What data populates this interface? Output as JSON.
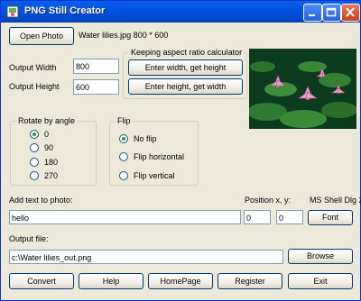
{
  "window": {
    "title": "PNG Still Creator"
  },
  "top": {
    "open_photo": "Open Photo",
    "file_info": "Water lilies.jpg 800 * 600"
  },
  "size": {
    "output_width_label": "Output Width",
    "output_width": "800",
    "output_height_label": "Output Height",
    "output_height": "600"
  },
  "aspect": {
    "title": "Keeping aspect ratio calculator",
    "width_btn": "Enter width, get height",
    "height_btn": "Enter height, get width"
  },
  "rotate": {
    "title": "Rotate by angle",
    "options": [
      "0",
      "90",
      "180",
      "270"
    ],
    "selected": "0"
  },
  "flip": {
    "title": "Flip",
    "options": [
      "No flip",
      "Flip horizontal",
      "Flip vertical"
    ],
    "selected": "No flip"
  },
  "text": {
    "label": "Add text to photo:",
    "value": "hello",
    "position_label": "Position x, y:",
    "x": "0",
    "y": "0",
    "font_name": "MS Shell Dlg 2",
    "font_btn": "Font"
  },
  "output": {
    "label": "Output file:",
    "path": "c:\\Water lilies_out.png",
    "browse": "Browse"
  },
  "footer": {
    "convert": "Convert",
    "help": "Help",
    "homepage": "HomePage",
    "register": "Register",
    "exit": "Exit"
  },
  "icons": {
    "app": "png-icon",
    "minimize": "minimize-icon",
    "maximize": "maximize-icon",
    "close": "close-icon"
  }
}
